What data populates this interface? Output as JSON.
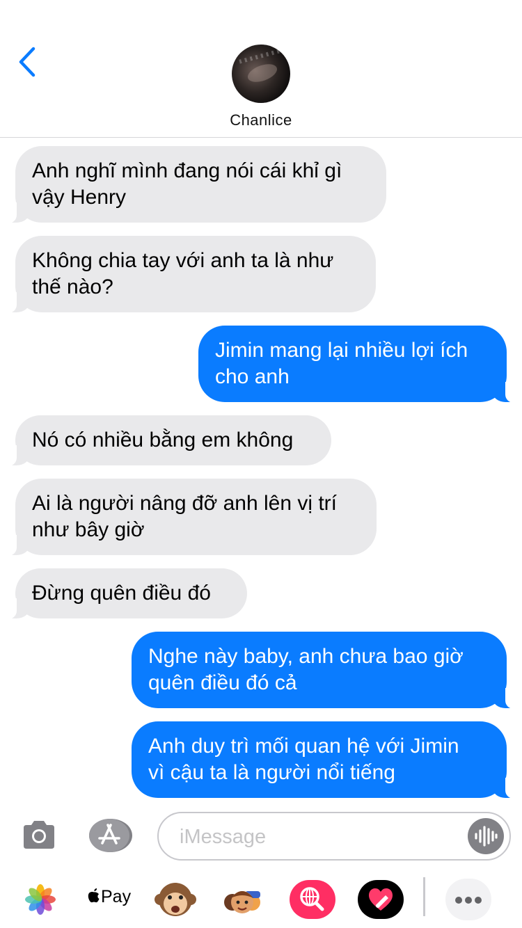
{
  "header": {
    "contact_name": "Chanlice"
  },
  "messages": [
    {
      "from": "received",
      "text_lines": [
        "Anh nghĩ mình đang nói cái khỉ gì",
        "vậy Henry"
      ]
    },
    {
      "from": "received",
      "text_lines": [
        "Không chia tay với anh ta là như",
        "thế nào?"
      ]
    },
    {
      "from": "sent",
      "text_lines": [
        "Jimin mang lại nhiều lợi ích",
        "cho anh"
      ]
    },
    {
      "from": "received",
      "text_lines": [
        "Nó có nhiều bằng em không"
      ]
    },
    {
      "from": "received",
      "text_lines": [
        "Ai là người nâng đỡ anh lên vị trí",
        "như bây giờ"
      ]
    },
    {
      "from": "received",
      "text_lines": [
        "Đừng quên điều đó"
      ]
    },
    {
      "from": "sent",
      "text_lines": [
        "Nghe này baby, anh chưa bao giờ",
        "quên điều đó cả"
      ]
    },
    {
      "from": "sent",
      "text_lines": [
        "Anh duy trì mối quan hệ với Jimin",
        "vì cậu ta là người nổi tiếng"
      ]
    }
  ],
  "composer": {
    "placeholder": "iMessage"
  },
  "app_drawer": {
    "apple_pay_label": "Pay",
    "icons": [
      "photos-icon",
      "apple-pay-icon",
      "monkey-animoji-icon",
      "memoji-icon",
      "web-search-icon",
      "digital-touch-icon",
      "more-icon"
    ]
  },
  "colors": {
    "sent_bubble": "#0a7cff",
    "received_bubble": "#e9e9eb",
    "back_chevron": "#0a7cff",
    "status_indicator": "#f5c400"
  }
}
